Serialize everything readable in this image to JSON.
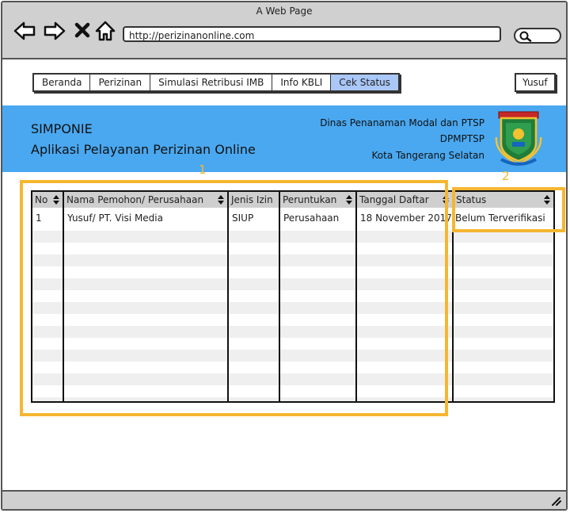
{
  "window": {
    "title": "A Web Page"
  },
  "browser": {
    "url": "http://perizinanonline.com",
    "icons": [
      "back-arrow-icon",
      "forward-arrow-icon",
      "close-x-icon",
      "home-icon",
      "search-icon"
    ]
  },
  "menu": {
    "tabs": [
      {
        "label": "Beranda",
        "active": false
      },
      {
        "label": "Perizinan",
        "active": false
      },
      {
        "label": "Simulasi Retribusi IMB",
        "active": false
      },
      {
        "label": "Info KBLI",
        "active": false
      },
      {
        "label": "Cek Status",
        "active": true
      }
    ],
    "user": "Yusuf"
  },
  "banner": {
    "app_name": "SIMPONIE",
    "app_subtitle": "Aplikasi Pelayanan Perizinan Online",
    "org_line1": "Dinas Penanaman Modal dan PTSP",
    "org_line2": "DPMPTSP",
    "org_line3": "Kota Tangerang Selatan",
    "color": "#4aa8f0"
  },
  "table": {
    "columns": [
      "No",
      "Nama Pemohon/ Perusahaan",
      "Jenis Izin",
      "Peruntukan",
      "Tanggal Daftar",
      "Status"
    ],
    "rows": [
      [
        "1",
        "Yusuf/ PT. Visi Media",
        "SIUP",
        "Perusahaan",
        "18 November 2017",
        "Belum Terverifikasi"
      ]
    ]
  },
  "annotations": {
    "label1": "1",
    "label2": "2",
    "color": "#f5b731"
  }
}
